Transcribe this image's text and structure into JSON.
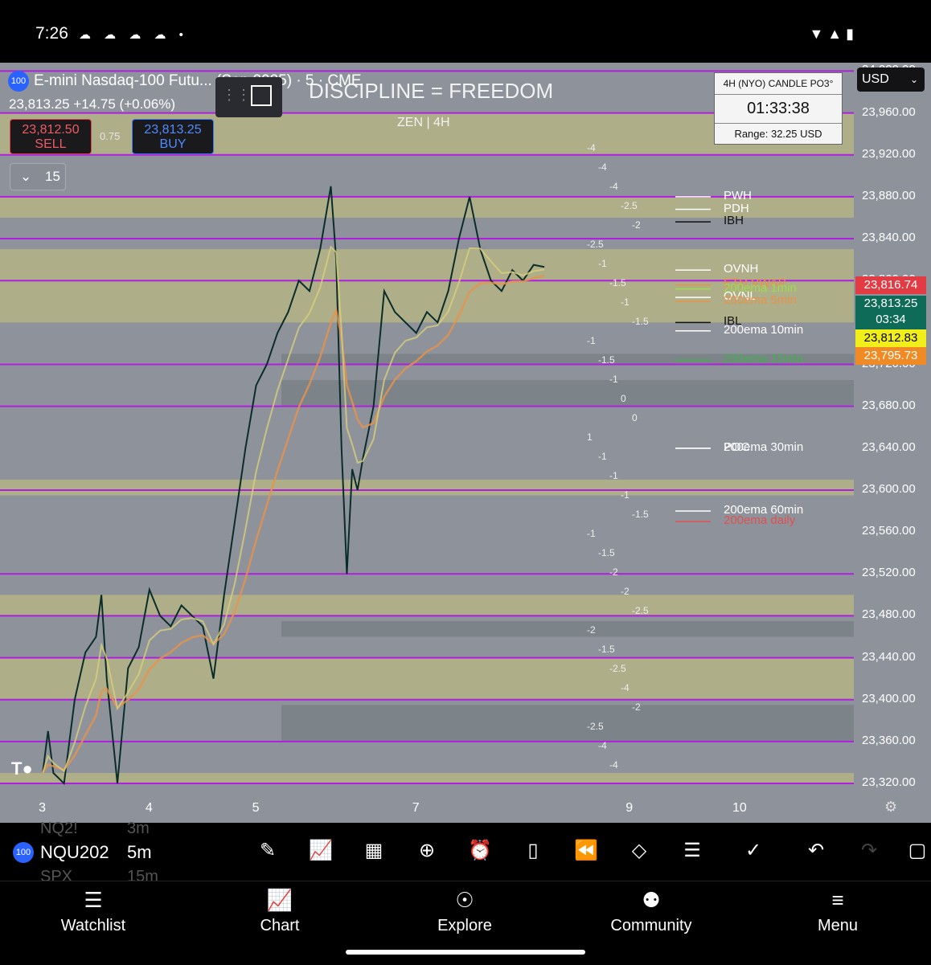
{
  "status_bar": {
    "time": "7:26",
    "notification_icons": "☁ ☁ ☁ ☁ •",
    "right_icons": "▼ ▲ ▮"
  },
  "symbol": {
    "title": "E-mini Nasdaq-100 Futu... (Sep 2025) · 5 · CME",
    "badge": "100",
    "price_line": "23,813.25  +14.75 (+0.06%)",
    "sell_price": "23,812.50",
    "sell_label": "SELL",
    "spread": "0.75",
    "buy_price": "23,813.25",
    "buy_label": "BUY",
    "collapse_count": "15"
  },
  "watermark": {
    "title": "DISCIPLINE = FREEDOM",
    "subtitle": "ZEN | 4H"
  },
  "candle_box": {
    "title": "4H (NYO) CANDLE PO3°",
    "timer": "01:33:38",
    "range": "Range: 32.25 USD"
  },
  "currency": "USD",
  "colors": {
    "background": "#8e939b",
    "magenta_line": "#b01ee0",
    "zone_fill": "#c9c47a",
    "grey_zone": "#6f7a7e",
    "up_candle": "#0b2d2a",
    "ema_orange": "#e8924a",
    "ema_yellow": "#d8cf7a"
  },
  "chart_data": {
    "type": "candlestick",
    "symbol": "NQU2025",
    "interval": "5m",
    "x_ticks": [
      "3",
      "4",
      "5",
      "7",
      "9",
      "10"
    ],
    "y_ticks": [
      "24,000.00",
      "23,960.00",
      "23,920.00",
      "23,880.00",
      "23,840.00",
      "23,800.00",
      "23,760.00",
      "23,720.00",
      "23,680.00",
      "23,640.00",
      "23,600.00",
      "23,560.00",
      "23,520.00",
      "23,480.00",
      "23,440.00",
      "23,400.00",
      "23,360.00",
      "23,320.00"
    ],
    "ylim": [
      23307,
      24008
    ],
    "price_path": [
      [
        3.0,
        23330
      ],
      [
        3.05,
        23370
      ],
      [
        3.1,
        23330
      ],
      [
        3.2,
        23320
      ],
      [
        3.3,
        23400
      ],
      [
        3.4,
        23445
      ],
      [
        3.5,
        23460
      ],
      [
        3.55,
        23500
      ],
      [
        3.6,
        23420
      ],
      [
        3.7,
        23320
      ],
      [
        3.8,
        23430
      ],
      [
        3.9,
        23450
      ],
      [
        4.0,
        23505
      ],
      [
        4.1,
        23480
      ],
      [
        4.2,
        23470
      ],
      [
        4.3,
        23490
      ],
      [
        4.4,
        23480
      ],
      [
        4.5,
        23470
      ],
      [
        4.6,
        23420
      ],
      [
        4.7,
        23500
      ],
      [
        4.8,
        23570
      ],
      [
        4.9,
        23640
      ],
      [
        5.0,
        23700
      ],
      [
        5.1,
        23720
      ],
      [
        5.2,
        23750
      ],
      [
        5.3,
        23770
      ],
      [
        5.4,
        23800
      ],
      [
        5.5,
        23790
      ],
      [
        5.6,
        23830
      ],
      [
        5.7,
        23890
      ],
      [
        5.75,
        23820
      ],
      [
        5.8,
        23640
      ],
      [
        5.85,
        23520
      ],
      [
        5.9,
        23620
      ],
      [
        5.95,
        23600
      ],
      [
        6.0,
        23630
      ],
      [
        6.1,
        23680
      ],
      [
        6.2,
        23790
      ],
      [
        6.3,
        23770
      ],
      [
        6.4,
        23760
      ],
      [
        6.5,
        23750
      ],
      [
        6.6,
        23770
      ],
      [
        6.7,
        23760
      ],
      [
        6.8,
        23790
      ],
      [
        6.9,
        23840
      ],
      [
        7.0,
        23880
      ],
      [
        7.1,
        23830
      ],
      [
        7.2,
        23800
      ],
      [
        7.3,
        23790
      ],
      [
        7.4,
        23810
      ],
      [
        7.5,
        23800
      ],
      [
        7.6,
        23815
      ],
      [
        7.7,
        23813
      ]
    ],
    "horizontal_levels": [
      "24,000",
      "23,960",
      "23,920",
      "23,880",
      "23,840",
      "23,800",
      "23,720",
      "23,680",
      "23,600",
      "23,520",
      "23,480",
      "23,440",
      "23,400",
      "23,360",
      "23,320"
    ],
    "level_labels": [
      {
        "text": "PWH",
        "color": "#ffffff",
        "value": 23880
      },
      {
        "text": "PDH",
        "color": "#ffffff",
        "value": 23868
      },
      {
        "text": "IBH",
        "color": "#111111",
        "value": 23856
      },
      {
        "text": "OVNH",
        "color": "#ffffff",
        "value": 23810
      },
      {
        "text": "ETH VWAP",
        "color": "#e8924a",
        "value": 23796
      },
      {
        "text": "200ema 1min",
        "color": "#9ede4a",
        "value": 23792
      },
      {
        "text": "OVNL",
        "color": "#ffffff",
        "value": 23784
      },
      {
        "text": "200ema 5min",
        "color": "#e8924a",
        "value": 23780
      },
      {
        "text": "IBL",
        "color": "#111111",
        "value": 23760
      },
      {
        "text": "200ema 10min",
        "color": "#ffffff",
        "value": 23752
      },
      {
        "text": "200ema 15min",
        "color": "#3fb24a",
        "value": 23724
      },
      {
        "text": "POC",
        "color": "#ffffff",
        "value": 23640
      },
      {
        "text": "200ema 30min",
        "color": "#ffffff",
        "value": 23640
      },
      {
        "text": "200ema 60min",
        "color": "#ffffff",
        "value": 23580
      },
      {
        "text": "200ema daily",
        "color": "#e05050",
        "value": 23570
      }
    ],
    "price_tags": [
      {
        "text": "23,816.74",
        "bg": "#e23b44",
        "value": 23816.74
      },
      {
        "text": "23,813.25",
        "sub": "03:34",
        "bg": "#0e6b57",
        "value": 23813.25
      },
      {
        "text": "23,812.83",
        "bg": "#f2ee1a",
        "fg": "#000000",
        "value": 23812.83
      },
      {
        "text": "23,795.73",
        "bg": "#f08a24",
        "value": 23795.73
      }
    ],
    "deviation_labels": [
      "-4",
      "-4",
      "-4",
      "-2.5",
      "-2",
      "-2.5",
      "-1",
      "-1.5",
      "-1",
      "-1.5",
      "-1",
      "-1.5",
      "-1",
      "0",
      "0",
      "1",
      "-1",
      "-1",
      "-1",
      "-1.5",
      "-1",
      "-1.5",
      "-2",
      "-2",
      "-2.5",
      "-2",
      "-1.5",
      "-2.5",
      "-4",
      "-2",
      "-2.5",
      "-4",
      "-4"
    ]
  },
  "toolbar": {
    "ticker_badge": "100",
    "ticker": "NQU202",
    "interval": "5m",
    "ghost_prev": "NQ2!",
    "ghost_prev_interval": "3m",
    "ghost_next": "SPX",
    "ghost_next_interval": "15m"
  },
  "bottom_nav": [
    {
      "label": "Watchlist",
      "icon": "list-icon"
    },
    {
      "label": "Chart",
      "icon": "chart-icon"
    },
    {
      "label": "Explore",
      "icon": "compass-icon"
    },
    {
      "label": "Community",
      "icon": "people-icon"
    },
    {
      "label": "Menu",
      "icon": "menu-icon"
    }
  ]
}
